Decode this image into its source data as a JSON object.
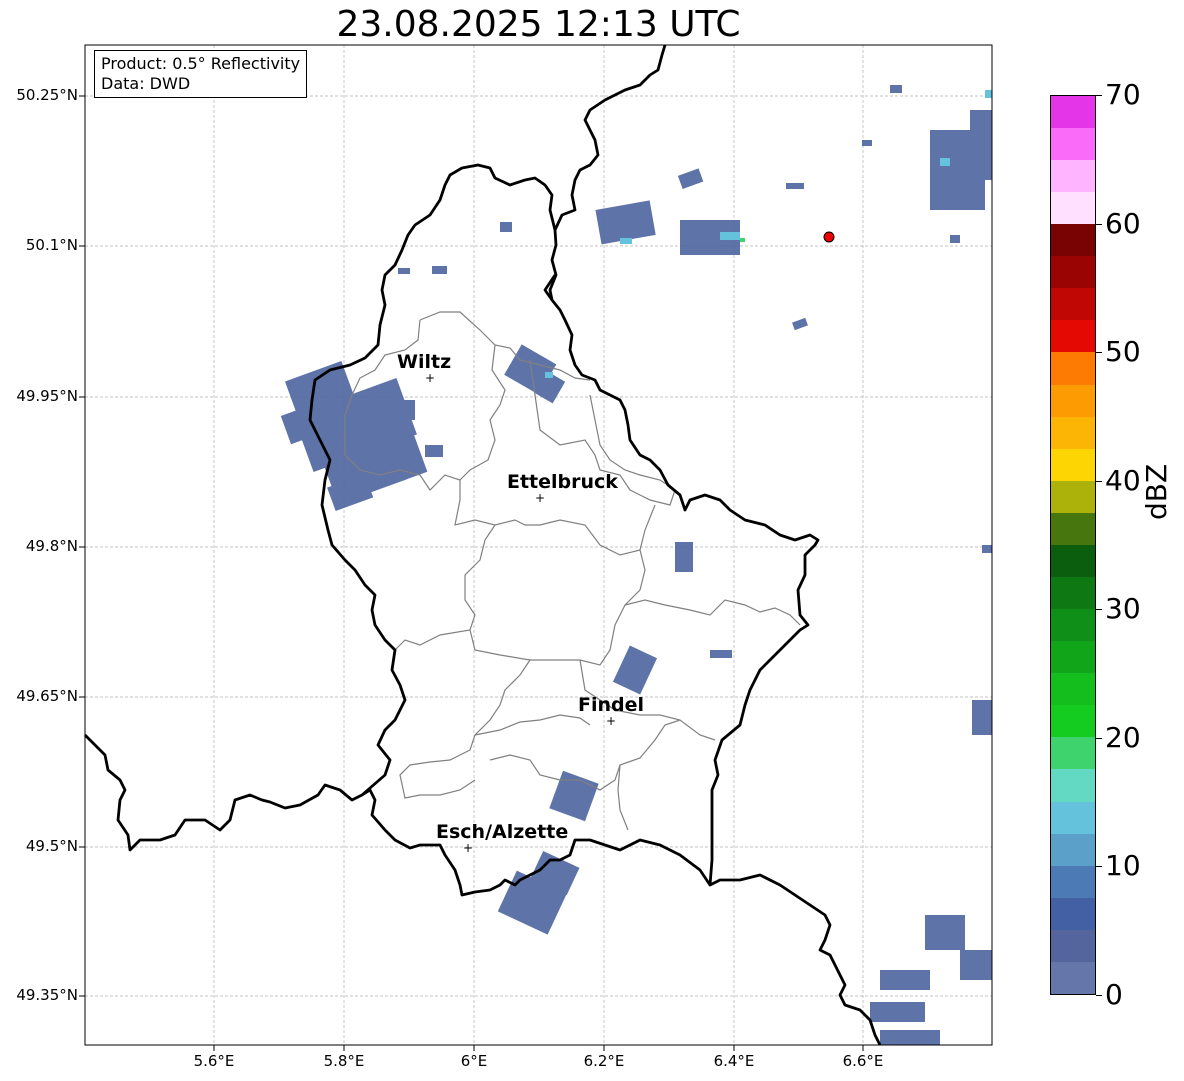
{
  "title": "23.08.2025 12:13 UTC",
  "info": {
    "product": "Product: 0.5° Reflectivity",
    "data": "Data: DWD"
  },
  "lat_labels": [
    "50.25°N",
    "50.1°N",
    "49.95°N",
    "49.8°N",
    "49.65°N",
    "49.5°N",
    "49.35°N"
  ],
  "lon_labels": [
    "5.6°E",
    "5.8°E",
    "6°E",
    "6.2°E",
    "6.4°E",
    "6.6°E"
  ],
  "cities": [
    {
      "name": "Wiltz"
    },
    {
      "name": "Ettelbruck"
    },
    {
      "name": "Findel"
    },
    {
      "name": "Esch/Alzette"
    }
  ],
  "colorbar": {
    "unit": "dBZ",
    "tick_labels": [
      "0",
      "10",
      "20",
      "30",
      "40",
      "50",
      "60",
      "70"
    ],
    "colors": [
      "#6577aa",
      "#54659e",
      "#4360a4",
      "#4b7ab5",
      "#5aa0c9",
      "#65c2dc",
      "#63d9c4",
      "#3ed36d",
      "#13cc1f",
      "#13be1d",
      "#11a61a",
      "#0f8f18",
      "#0e7812",
      "#0a5e0e",
      "#47760f",
      "#adb20b",
      "#fdd502",
      "#fdb505",
      "#fd9b02",
      "#fd7b02",
      "#e40a03",
      "#c10703",
      "#9a0504",
      "#780302",
      "#ffe0ff",
      "#ffb4ff",
      "#fb6bfa",
      "#e436e8"
    ]
  },
  "marker": {
    "color": "#ee0000"
  }
}
